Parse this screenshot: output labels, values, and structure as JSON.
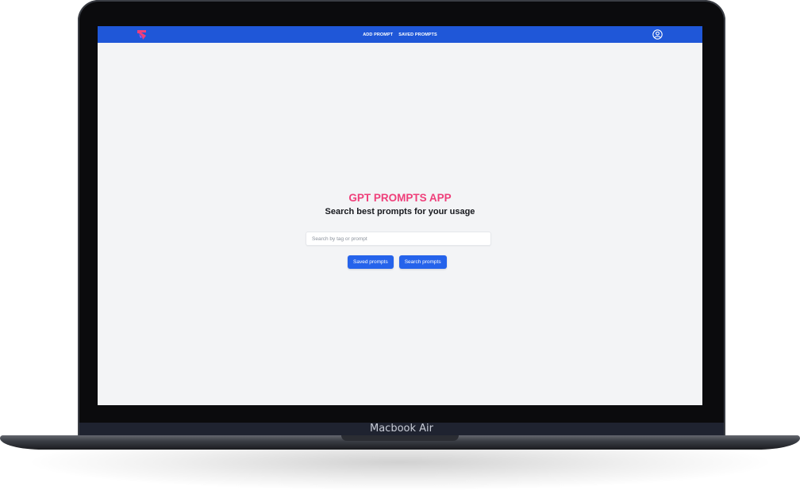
{
  "device": {
    "label": "Macbook Air"
  },
  "navbar": {
    "background_color": "#1f57d8",
    "logo_icon": "brand-logo-icon",
    "links": [
      {
        "label": "ADD PROMPT"
      },
      {
        "label": "SAVED PROMPTS"
      }
    ],
    "user_icon": "user-circle-icon"
  },
  "hero": {
    "title": "GPT PROMPTS APP",
    "title_color": "#ef3f7a",
    "subtitle": "Search best prompts for your usage"
  },
  "search": {
    "placeholder": "Search by tag or prompt",
    "value": ""
  },
  "actions": {
    "saved_label": "Saved prompts",
    "search_label": "Search prompts",
    "button_color": "#2563eb"
  },
  "theme": {
    "page_background": "#f3f4f6"
  }
}
